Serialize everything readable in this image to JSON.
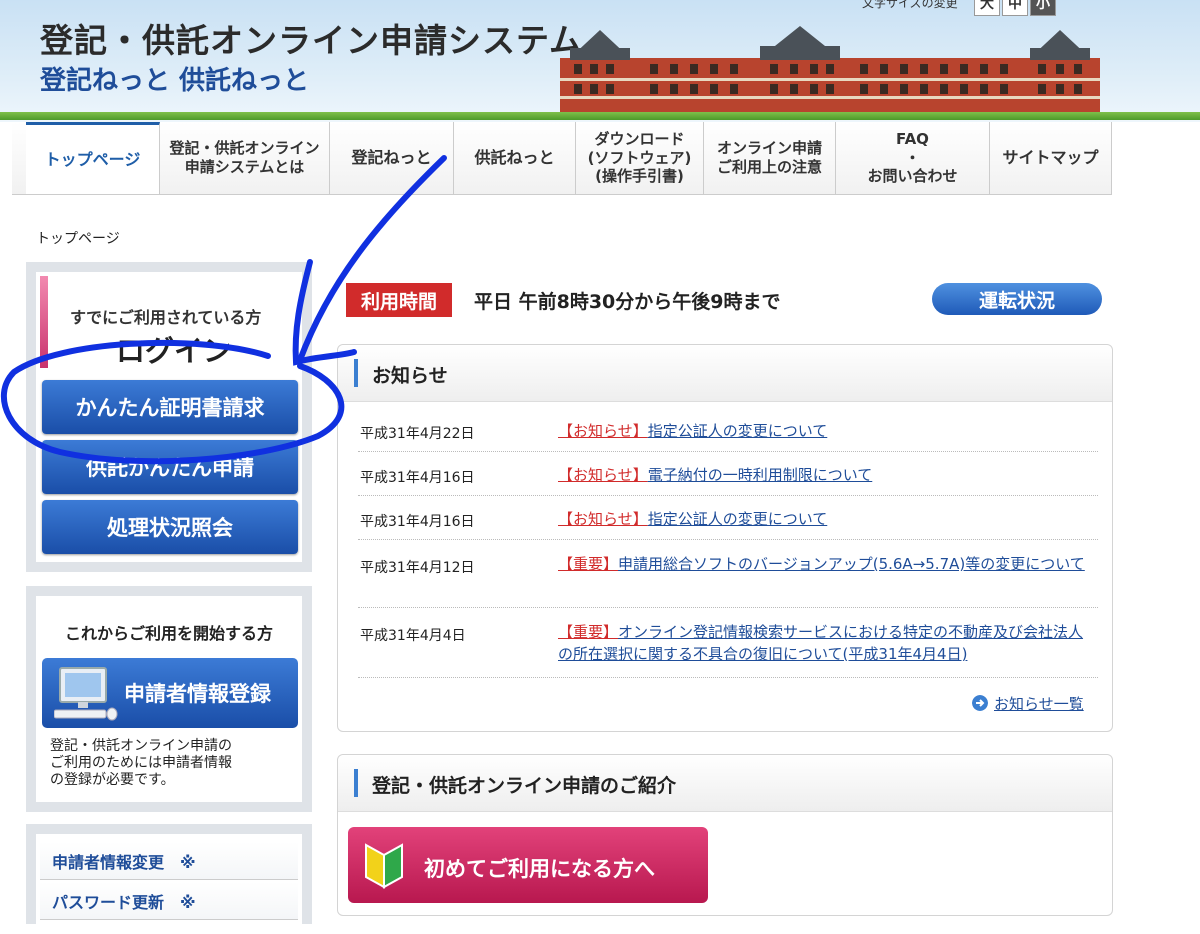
{
  "header": {
    "title_main": "登記・供託オンライン申請システム",
    "title_sub": "登記ねっと 供託ねっと",
    "text_size_label": "文字サイズの変更",
    "text_size_options": [
      "大",
      "中",
      "小"
    ],
    "text_size_selected": "小"
  },
  "nav": {
    "items": [
      {
        "label": "トップページ"
      },
      {
        "label": "登記・供託オンライン\n申請システムとは"
      },
      {
        "label": "登記ねっと"
      },
      {
        "label": "供託ねっと"
      },
      {
        "label": "ダウンロード\n(ソフトウェア)\n(操作手引書)"
      },
      {
        "label": "オンライン申請\nご利用上の注意"
      },
      {
        "label": "FAQ\n・\nお問い合わせ"
      },
      {
        "label": "サイトマップ"
      }
    ],
    "active": "トップページ"
  },
  "breadcrumb": "トップページ",
  "login_panel": {
    "already_label": "すでにご利用されている方",
    "login_title": "ログイン",
    "buttons": [
      "かんたん証明書請求",
      "供託かんたん申請",
      "処理状況照会"
    ]
  },
  "start_panel": {
    "title": "これからご利用を開始する方",
    "register_button": "申請者情報登録",
    "note": "登記・供託オンライン申請の\nご利用のためには申請者情報\nの登録が必要です。"
  },
  "menu_panel": {
    "items": [
      "申請者情報変更　※",
      "パスワード更新　※"
    ]
  },
  "hours": {
    "tag": "利用時間",
    "text": "平日 午前8時30分から午後9時まで",
    "status_button": "運転状況"
  },
  "news": {
    "title": "お知らせ",
    "items": [
      {
        "date": "平成31年4月22日",
        "tag": "【お知らせ】",
        "text": "指定公証人の変更について"
      },
      {
        "date": "平成31年4月16日",
        "tag": "【お知らせ】",
        "text": "電子納付の一時利用制限について"
      },
      {
        "date": "平成31年4月16日",
        "tag": "【お知らせ】",
        "text": "指定公証人の変更について"
      },
      {
        "date": "平成31年4月12日",
        "tag": "【重要】",
        "text": "申請用総合ソフトのバージョンアップ(5.6A→5.7A)等の変更について"
      },
      {
        "date": "平成31年4月4日",
        "tag": "【重要】",
        "text": "オンライン登記情報検索サービスにおける特定の不動産及び会社法人の所在選択に関する不具合の復旧について(平成31年4月4日)"
      }
    ],
    "more_link": "お知らせ一覧"
  },
  "intro": {
    "title": "登記・供託オンライン申請のご紹介",
    "first_time_button": "初めてご利用になる方へ"
  },
  "colors": {
    "nav_active": "#1f5ea8",
    "button_blue": "#1a4ea8",
    "tag_red": "#d12b2b",
    "first_time_pink": "#c81d57",
    "annotation_blue": "#1030e0"
  }
}
